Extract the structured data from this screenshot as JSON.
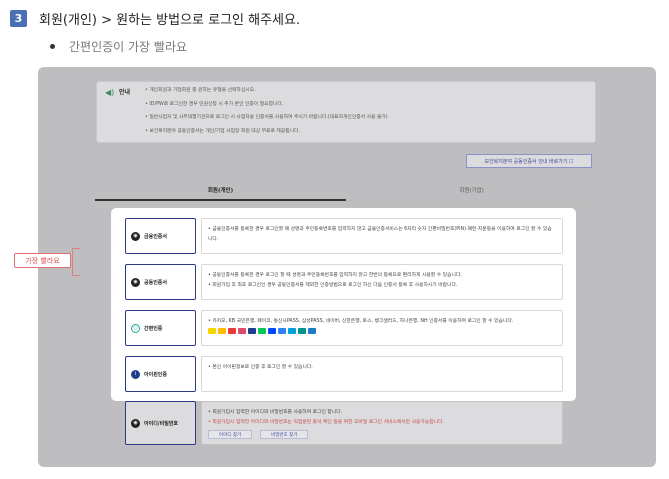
{
  "step": {
    "number": "3",
    "title": "회원(개인) > 원하는 방법으로 로그인 해주세요."
  },
  "tip": {
    "text": "간편인증이 가장 빨라요"
  },
  "notice": {
    "label": "안내",
    "items": [
      "개인회원과 기업회원 중 원하는 유형을 선택하십시오.",
      "ID/PW로 로그인한 경우 민원신청 시 추가 본인 인증이 필요합니다.",
      "일반사업자 및 사무대행기관으로 로그인 시 사업자용 인증서를 사용하여 주시기 바랍니다.(대표자개인인증서 사용 불가)",
      "보건복지분야 공동인증서는 개인/기업 사업장 회원 대상 무료로 제공됩니다."
    ]
  },
  "bokji_link": "보건복지분야 공동인증서 안내 바로가기 ☐",
  "tabs": [
    {
      "label": "회원(개인)",
      "active": true
    },
    {
      "label": "회원(기업)",
      "active": false
    }
  ],
  "methods": [
    {
      "label": "금융인증서",
      "icon": "certificate-icon",
      "desc": [
        "금융인증서를 등록한 경우 로그인할 때 성명과 주민등록번호를 입력하지 않고 금융인증서비스는 6자리 숫자 간편비밀번호(PIN)·패턴·지문등을 이용하여 로그인 할 수 있습니다."
      ]
    },
    {
      "label": "공동인증서",
      "icon": "certificate-icon",
      "desc": [
        "공동인증서를 등록한 경우 로그인 할 때 성명과 주민등록번호를 입력하지 않고 한번의 등록으로 편리하게 사용할 수 있습니다.",
        "회원가입 후 최초 로그인인 경우 공동인증서를 제외한 인증방법으로 로그인 하신 다음 인증서 등록 후 사용하시기 바랍니다."
      ]
    },
    {
      "label": "간편인증",
      "icon": "simple-auth-icon",
      "desc": [
        "카카오, KB 국민은행, 페이코, 통신사PASS, 삼성PASS, 네이버, 신한은행, 토스, 뱅크샐러드, 하나은행, NH 인증서를 이용하여 로그인 할 수 있습니다."
      ]
    },
    {
      "label": "아이핀인증",
      "icon": "ipin-icon",
      "desc": [
        "본인 아이핀정보로 인증 후 로그인 할 수 있습니다."
      ]
    }
  ],
  "fast_badge": "가장 빨라요",
  "id_login": {
    "label": "아이디/비밀번호",
    "desc": "회원가입시 입력한 아이디와 비밀번호를 사용하여 로그인 합니다.",
    "warning": "회원가입시 입력한 아이디와 비밀번호는 직업훈련 출석 확인 등을 위한 모바일 로그인 서비스에서만 사용가능합니다.",
    "find_id": "아이디 찾기",
    "find_pw": "비밀번호 찾기"
  },
  "colors": {
    "accent": "#2d3a85",
    "step_badge": "#4a6fb5",
    "simple_auth": "#1ea89a",
    "badge_red": "#d9534f"
  }
}
